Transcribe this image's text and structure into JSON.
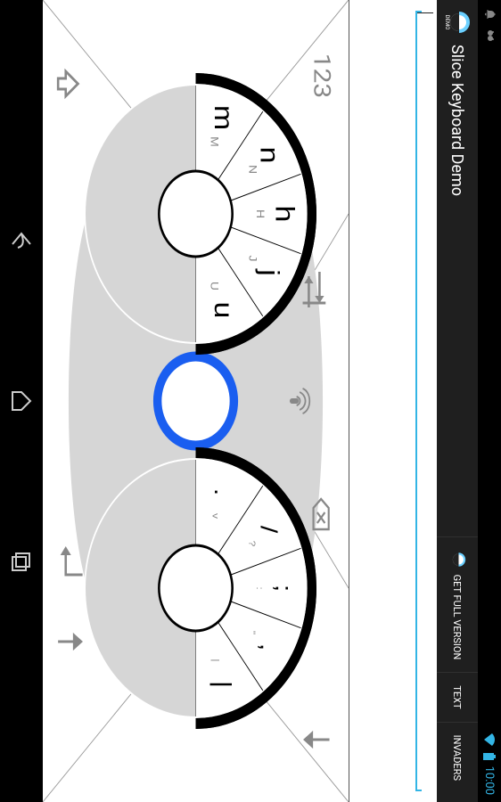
{
  "statusbar": {
    "time": "10:00"
  },
  "actionbar": {
    "title": "Slice Keyboard Demo",
    "actions": {
      "full": "GET FULL VERSION",
      "text": "TEXT",
      "invaders": "INVADERS"
    }
  },
  "keyboard": {
    "left": {
      "slices": [
        {
          "big": "u",
          "small": "U"
        },
        {
          "big": "j",
          "small": "J"
        },
        {
          "big": "h",
          "small": "H"
        },
        {
          "big": "n",
          "small": "N"
        },
        {
          "big": "m",
          "small": "M"
        }
      ]
    },
    "right": {
      "slices": [
        {
          "big": "|",
          "small": "|"
        },
        {
          "big": ",",
          "small": "\""
        },
        {
          "big": ";",
          "small": ":"
        },
        {
          "big": "/",
          "small": "?"
        },
        {
          "big": ".",
          "small": "v"
        }
      ]
    },
    "aux": {
      "numbers": "123"
    }
  }
}
